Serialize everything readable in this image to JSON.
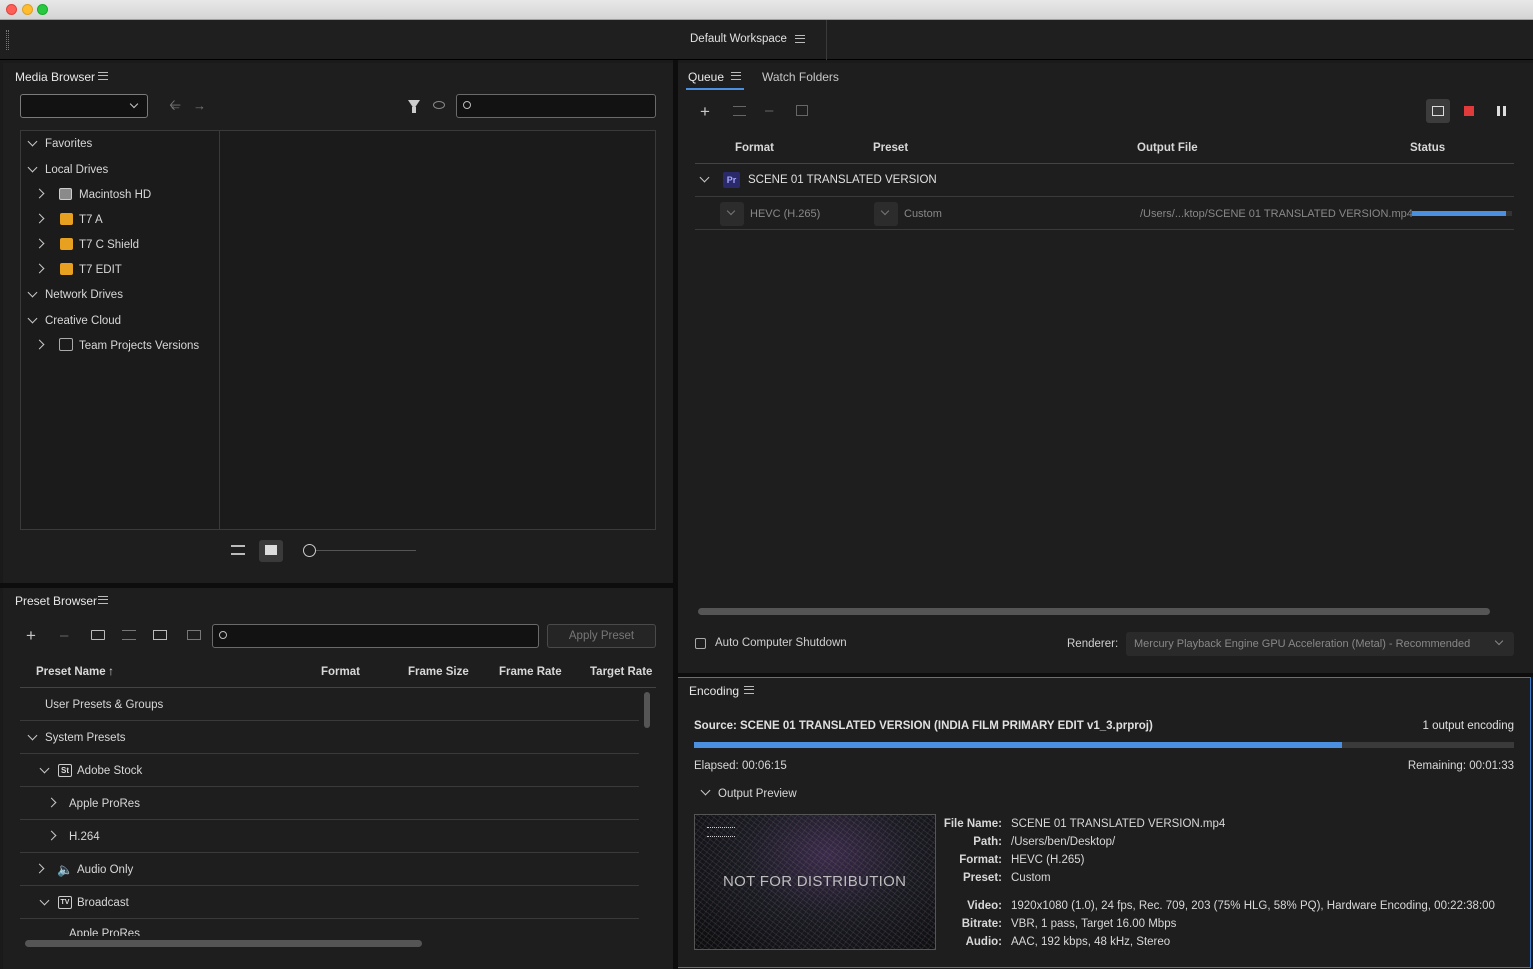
{
  "workspace": {
    "title": "Default Workspace"
  },
  "media_browser": {
    "title": "Media Browser",
    "search_placeholder": "",
    "tree": [
      {
        "label": "Favorites",
        "level": 0,
        "expanded": true
      },
      {
        "label": "Local Drives",
        "level": 0,
        "expanded": true
      },
      {
        "label": "Macintosh HD",
        "level": 1,
        "expanded": false,
        "icon": "hard-drive-icon"
      },
      {
        "label": "T7 A",
        "level": 1,
        "expanded": false,
        "icon": "external-drive-icon"
      },
      {
        "label": "T7 C Shield",
        "level": 1,
        "expanded": false,
        "icon": "external-drive-icon"
      },
      {
        "label": "T7 EDIT",
        "level": 1,
        "expanded": false,
        "icon": "external-drive-icon"
      },
      {
        "label": "Network Drives",
        "level": 0,
        "expanded": true
      },
      {
        "label": "Creative Cloud",
        "level": 0,
        "expanded": true
      },
      {
        "label": "Team Projects Versions",
        "level": 1,
        "expanded": false,
        "icon": "team-projects-icon"
      }
    ]
  },
  "preset_browser": {
    "title": "Preset Browser",
    "apply_label": "Apply Preset",
    "columns": {
      "name": "Preset Name",
      "format": "Format",
      "frame_size": "Frame Size",
      "frame_rate": "Frame Rate",
      "target_rate": "Target Rate"
    },
    "rows": [
      {
        "label": "User Presets & Groups"
      },
      {
        "label": "System Presets"
      },
      {
        "label": "Adobe Stock",
        "icon_text": "St"
      },
      {
        "label": "Apple ProRes"
      },
      {
        "label": "H.264"
      },
      {
        "label": "Audio Only"
      },
      {
        "label": "Broadcast",
        "icon_text": "TV"
      },
      {
        "label": "Apple ProRes"
      }
    ]
  },
  "queue": {
    "tab_queue": "Queue",
    "tab_watch": "Watch Folders",
    "columns": {
      "format": "Format",
      "preset": "Preset",
      "output": "Output File",
      "status": "Status"
    },
    "item": {
      "badge": "Pr",
      "name": "SCENE 01 TRANSLATED VERSION",
      "format": "HEVC (H.265)",
      "preset": "Custom",
      "output": "/Users/...ktop/SCENE 01 TRANSLATED VERSION.mp4",
      "progress": 0.94
    },
    "auto_shutdown_label": "Auto Computer Shutdown",
    "renderer_label": "Renderer:",
    "renderer_value": "Mercury Playback Engine GPU Acceleration (Metal) - Recommended"
  },
  "encoding": {
    "title": "Encoding",
    "source": "Source: SCENE 01 TRANSLATED VERSION (INDIA FILM PRIMARY EDIT v1_3.prproj)",
    "output_count": "1 output encoding",
    "progress": 0.79,
    "elapsed": "Elapsed: 00:06:15",
    "remaining": "Remaining: 00:01:33",
    "preview_label": "Output Preview",
    "watermark": "NOT FOR DISTRIBUTION",
    "meta": {
      "file_name_label": "File Name:",
      "file_name": "SCENE 01 TRANSLATED VERSION.mp4",
      "path_label": "Path:",
      "path": "/Users/ben/Desktop/",
      "format_label": "Format:",
      "format": "HEVC (H.265)",
      "preset_label": "Preset:",
      "preset": "Custom",
      "video_label": "Video:",
      "video": "1920x1080 (1.0), 24 fps, Rec. 709, 203 (75% HLG, 58% PQ), Hardware Encoding, 00:22:38:00",
      "bitrate_label": "Bitrate:",
      "bitrate": "VBR, 1 pass, Target 16.00 Mbps",
      "audio_label": "Audio:",
      "audio": "AAC, 192 kbps, 48 kHz, Stereo"
    }
  },
  "colors": {
    "accent_blue": "#4a8fe0",
    "stop_red": "#e03a3a",
    "drive_orange": "#e8a020",
    "pr_badge": "#2a2a6a"
  }
}
